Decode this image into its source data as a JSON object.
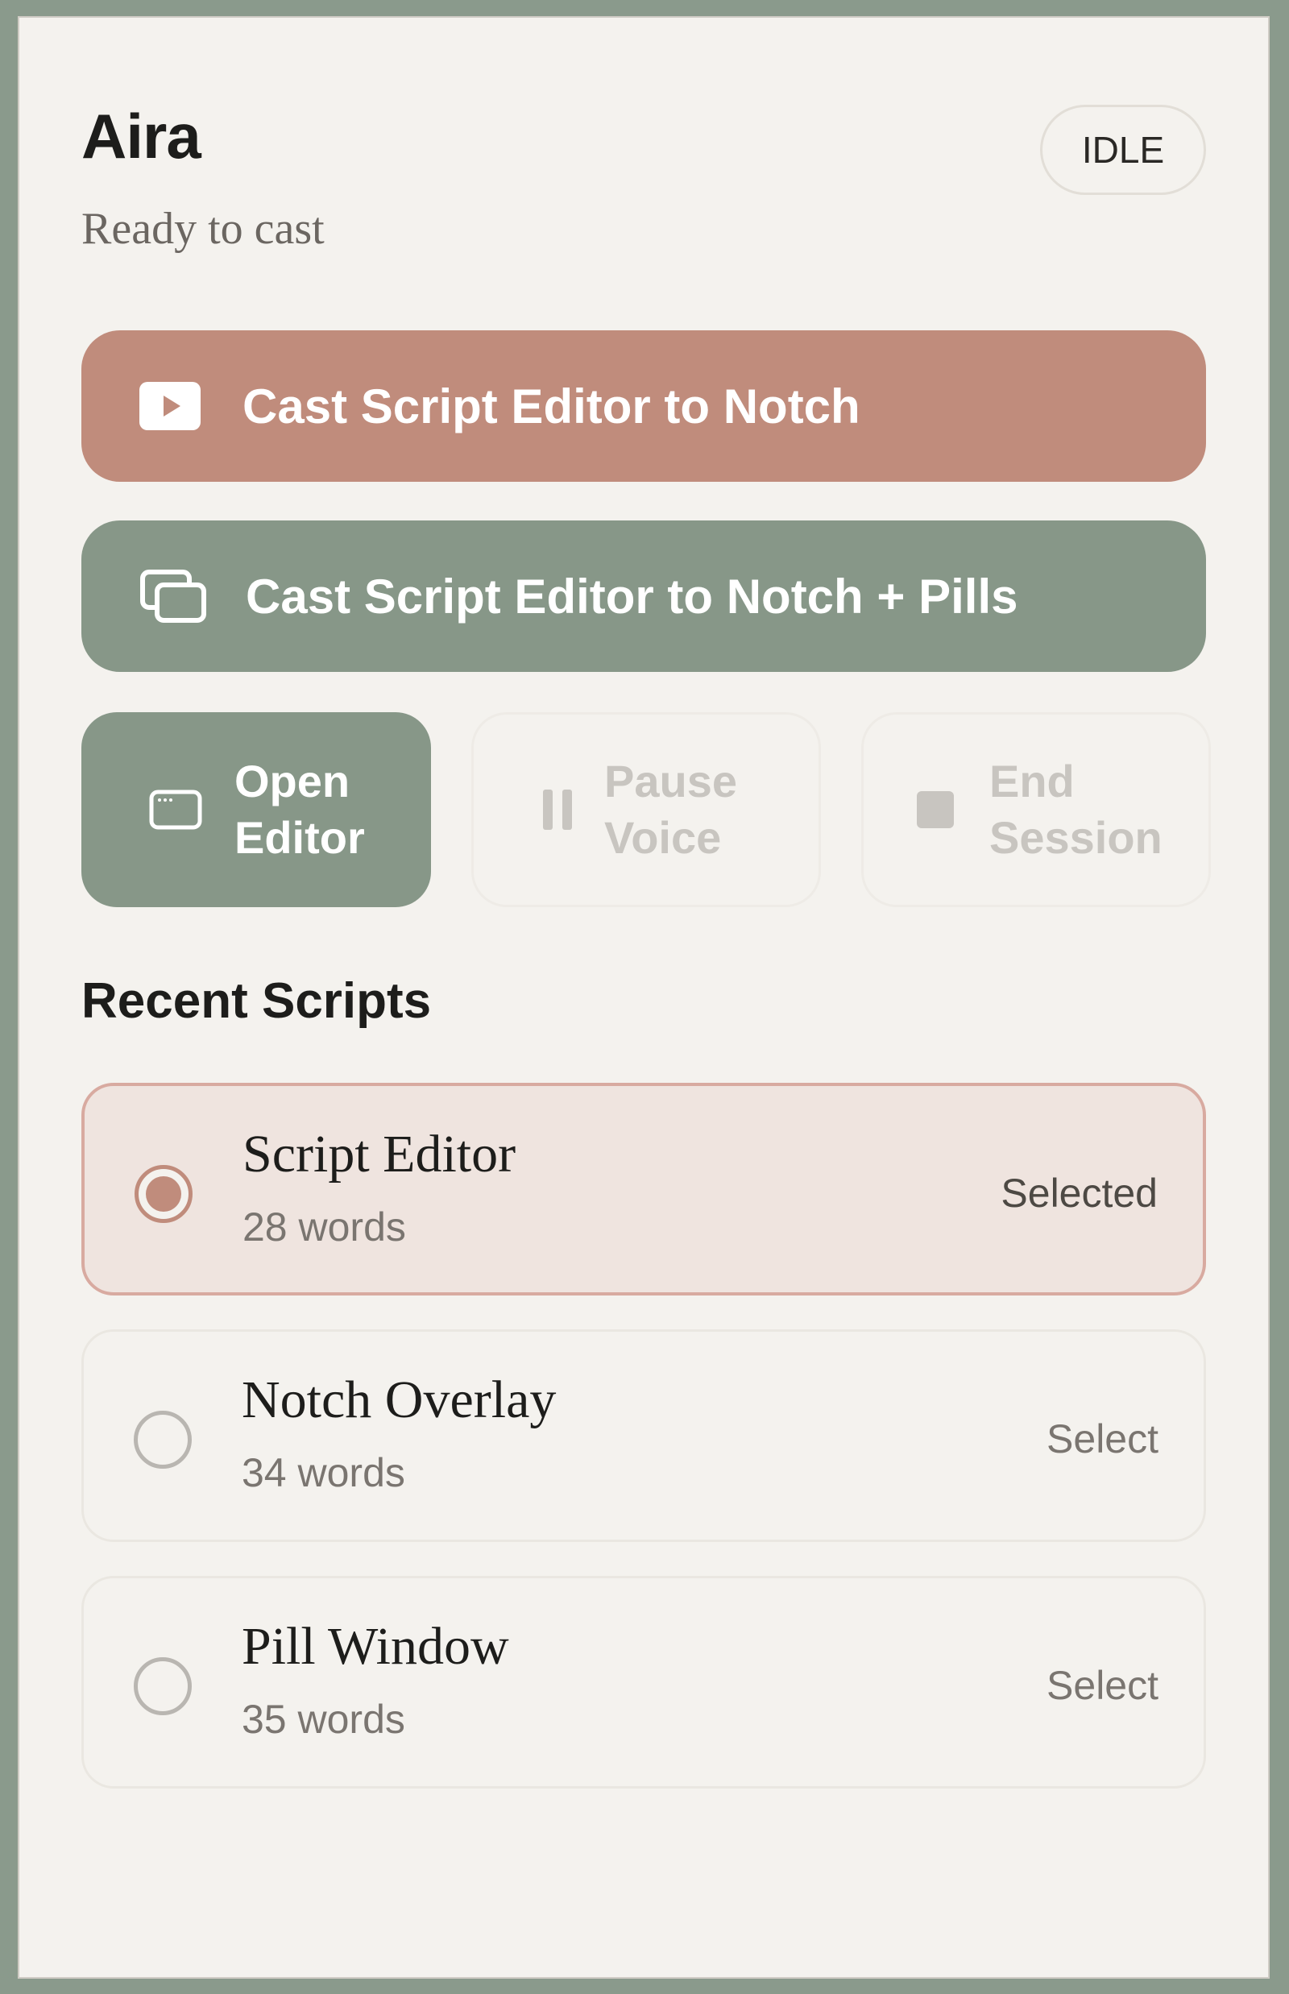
{
  "app": {
    "title": "Aira",
    "subtitle": "Ready to cast",
    "status": "IDLE"
  },
  "actions": {
    "cast_notch": {
      "label": "Cast Script Editor to Notch",
      "icon": "play-icon"
    },
    "cast_notch_pills": {
      "label": "Cast Script Editor to Notch + Pills",
      "icon": "stacked-windows-icon"
    },
    "open_editor": {
      "label": "Open Editor",
      "icon": "window-icon"
    },
    "pause_voice": {
      "label": "Pause Voice",
      "icon": "pause-icon",
      "enabled": false
    },
    "end_session": {
      "label": "End Session",
      "icon": "stop-icon",
      "enabled": false
    }
  },
  "recent": {
    "title": "Recent Scripts",
    "items": [
      {
        "name": "Script Editor",
        "count": "28 words",
        "action": "Selected",
        "selected": true
      },
      {
        "name": "Notch Overlay",
        "count": "34 words",
        "action": "Select",
        "selected": false
      },
      {
        "name": "Pill Window",
        "count": "35 words",
        "action": "Select",
        "selected": false
      }
    ]
  },
  "colors": {
    "background": "#8a9a8c",
    "panel": "#f4f2ee",
    "accent_terracotta": "#c08c7c",
    "accent_sage": "#879788",
    "selected_fill": "#efe4df"
  }
}
